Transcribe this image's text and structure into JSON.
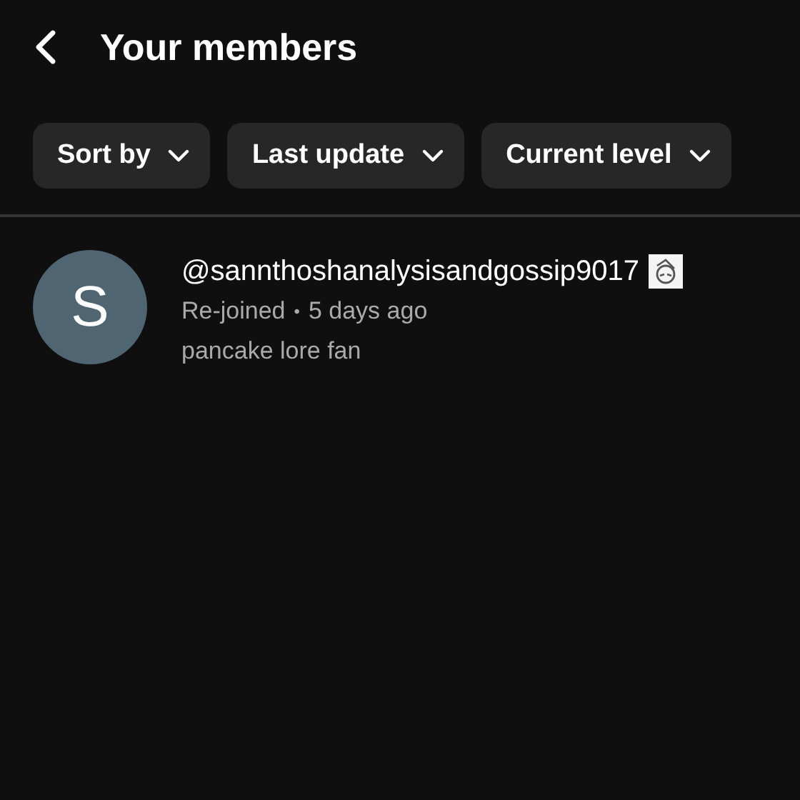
{
  "header": {
    "title": "Your members"
  },
  "filters": [
    {
      "label": "Sort by"
    },
    {
      "label": "Last update"
    },
    {
      "label": "Current level"
    }
  ],
  "members": [
    {
      "avatar_letter": "S",
      "handle": "@sannthoshanalysisandgossip9017",
      "status": "Re-joined",
      "separator": "•",
      "time": "5 days ago",
      "level_name": "pancake lore fan"
    }
  ]
}
